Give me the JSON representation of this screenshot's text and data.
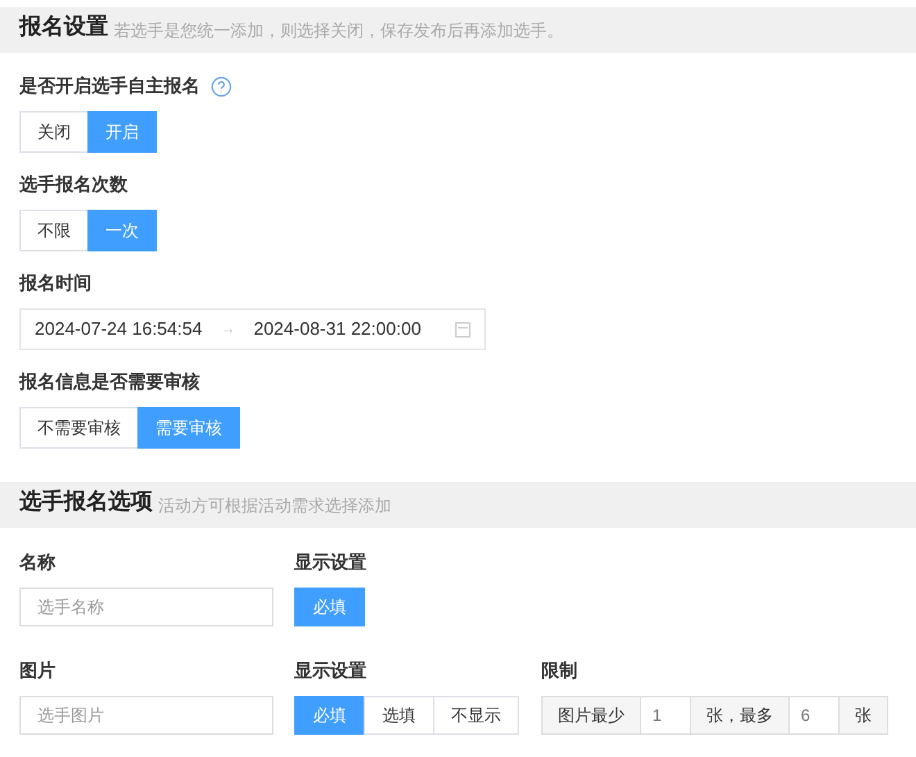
{
  "section_1": {
    "title": "报名设置",
    "hint": "若选手是您统一添加，则选择关闭，保存发布后再添加选手。"
  },
  "self_signup": {
    "label": "是否开启选手自主报名",
    "help": true,
    "options": [
      {
        "label": "关闭",
        "selected": false
      },
      {
        "label": "开启",
        "selected": true
      }
    ]
  },
  "signup_count": {
    "label": "选手报名次数",
    "options": [
      {
        "label": "不限",
        "selected": false
      },
      {
        "label": "一次",
        "selected": true
      }
    ]
  },
  "signup_time": {
    "label": "报名时间",
    "start": "2024-07-24 16:54:54",
    "arrow": "→",
    "end": "2024-08-31 22:00:00"
  },
  "review": {
    "label": "报名信息是否需要审核",
    "options": [
      {
        "label": "不需要审核",
        "selected": false
      },
      {
        "label": "需要审核",
        "selected": true
      }
    ]
  },
  "section_2": {
    "title": "选手报名选项",
    "hint": "活动方可根据活动需求选择添加"
  },
  "fields": [
    {
      "label": "名称",
      "placeholder": "选手名称",
      "display_label": "显示设置",
      "display_options": [
        {
          "label": "必填",
          "selected": true
        }
      ]
    },
    {
      "label": "图片",
      "placeholder": "选手图片",
      "display_label": "显示设置",
      "display_options": [
        {
          "label": "必填",
          "selected": true
        },
        {
          "label": "选填",
          "selected": false
        },
        {
          "label": "不显示",
          "selected": false
        }
      ],
      "limit": {
        "label": "限制",
        "prefix": "图片最少",
        "min": "1",
        "middle": "张，最多",
        "max": "6",
        "suffix": "张"
      }
    }
  ]
}
